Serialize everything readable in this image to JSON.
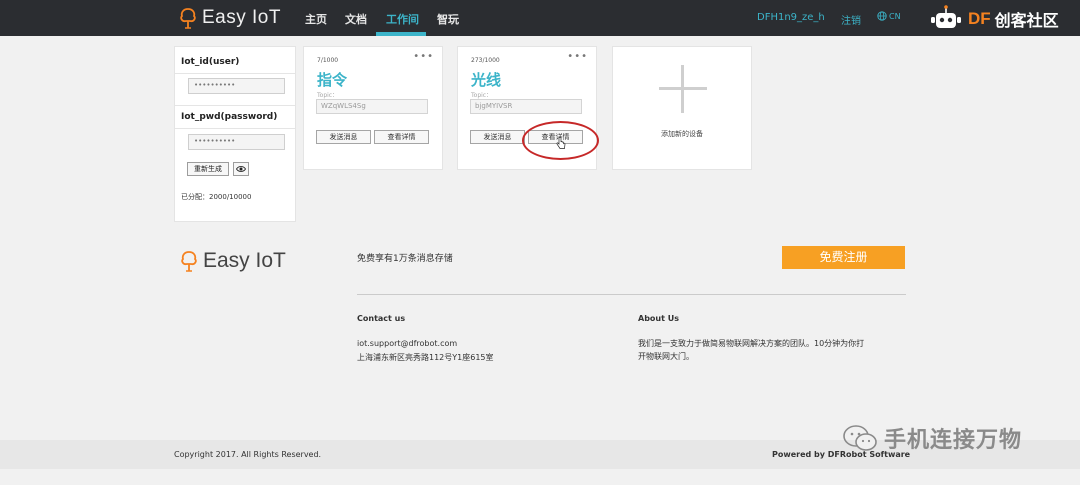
{
  "nav": {
    "logo": "Easy IoT",
    "items": [
      "主页",
      "文档",
      "工作间",
      "智玩"
    ],
    "user": "DFH1n9_ze_h",
    "logout": "注销",
    "lang": "CN",
    "brand_df": "DF",
    "brand_rest": "创客社区"
  },
  "cred": {
    "id_label": "Iot_id(user)",
    "id_value": "••••••••••",
    "pwd_label": "Iot_pwd(password)",
    "pwd_value": "••••••••••",
    "regen": "重新生成",
    "allocated": "已分配：2000/10000"
  },
  "devices": [
    {
      "count": "7/1000",
      "name": "指令",
      "topic_label": "Topic：",
      "topic": "WZqWLS4Sg",
      "send": "发送消息",
      "details": "查看详情"
    },
    {
      "count": "273/1000",
      "name": "光线",
      "topic_label": "Topic：",
      "topic": "bjgMYIVSR",
      "send": "发送消息",
      "details": "查看详情"
    }
  ],
  "add_device": "添加新的设备",
  "footer": {
    "logo": "Easy IoT",
    "slogan": "免费享有1万条消息存储",
    "register": "免费注册",
    "contact_title": "Contact us",
    "email": "iot.support@dfrobot.com",
    "address": "上海浦东新区亮秀路112号Y1座615室",
    "about_title": "About Us",
    "about_line1": "我们是一支致力于做简易物联网解决方案的团队。10分钟为你打",
    "about_line2": "开物联网大门。",
    "copyright": "Copyright 2017. All Rights Reserved.",
    "powered": "Powered by DFRobot Software"
  },
  "watermark": "手机连接万物",
  "colors": {
    "accent": "#3cb4c9",
    "nav_bg": "#2b2d31",
    "register": "#f7a023",
    "highlight": "#c62828"
  }
}
